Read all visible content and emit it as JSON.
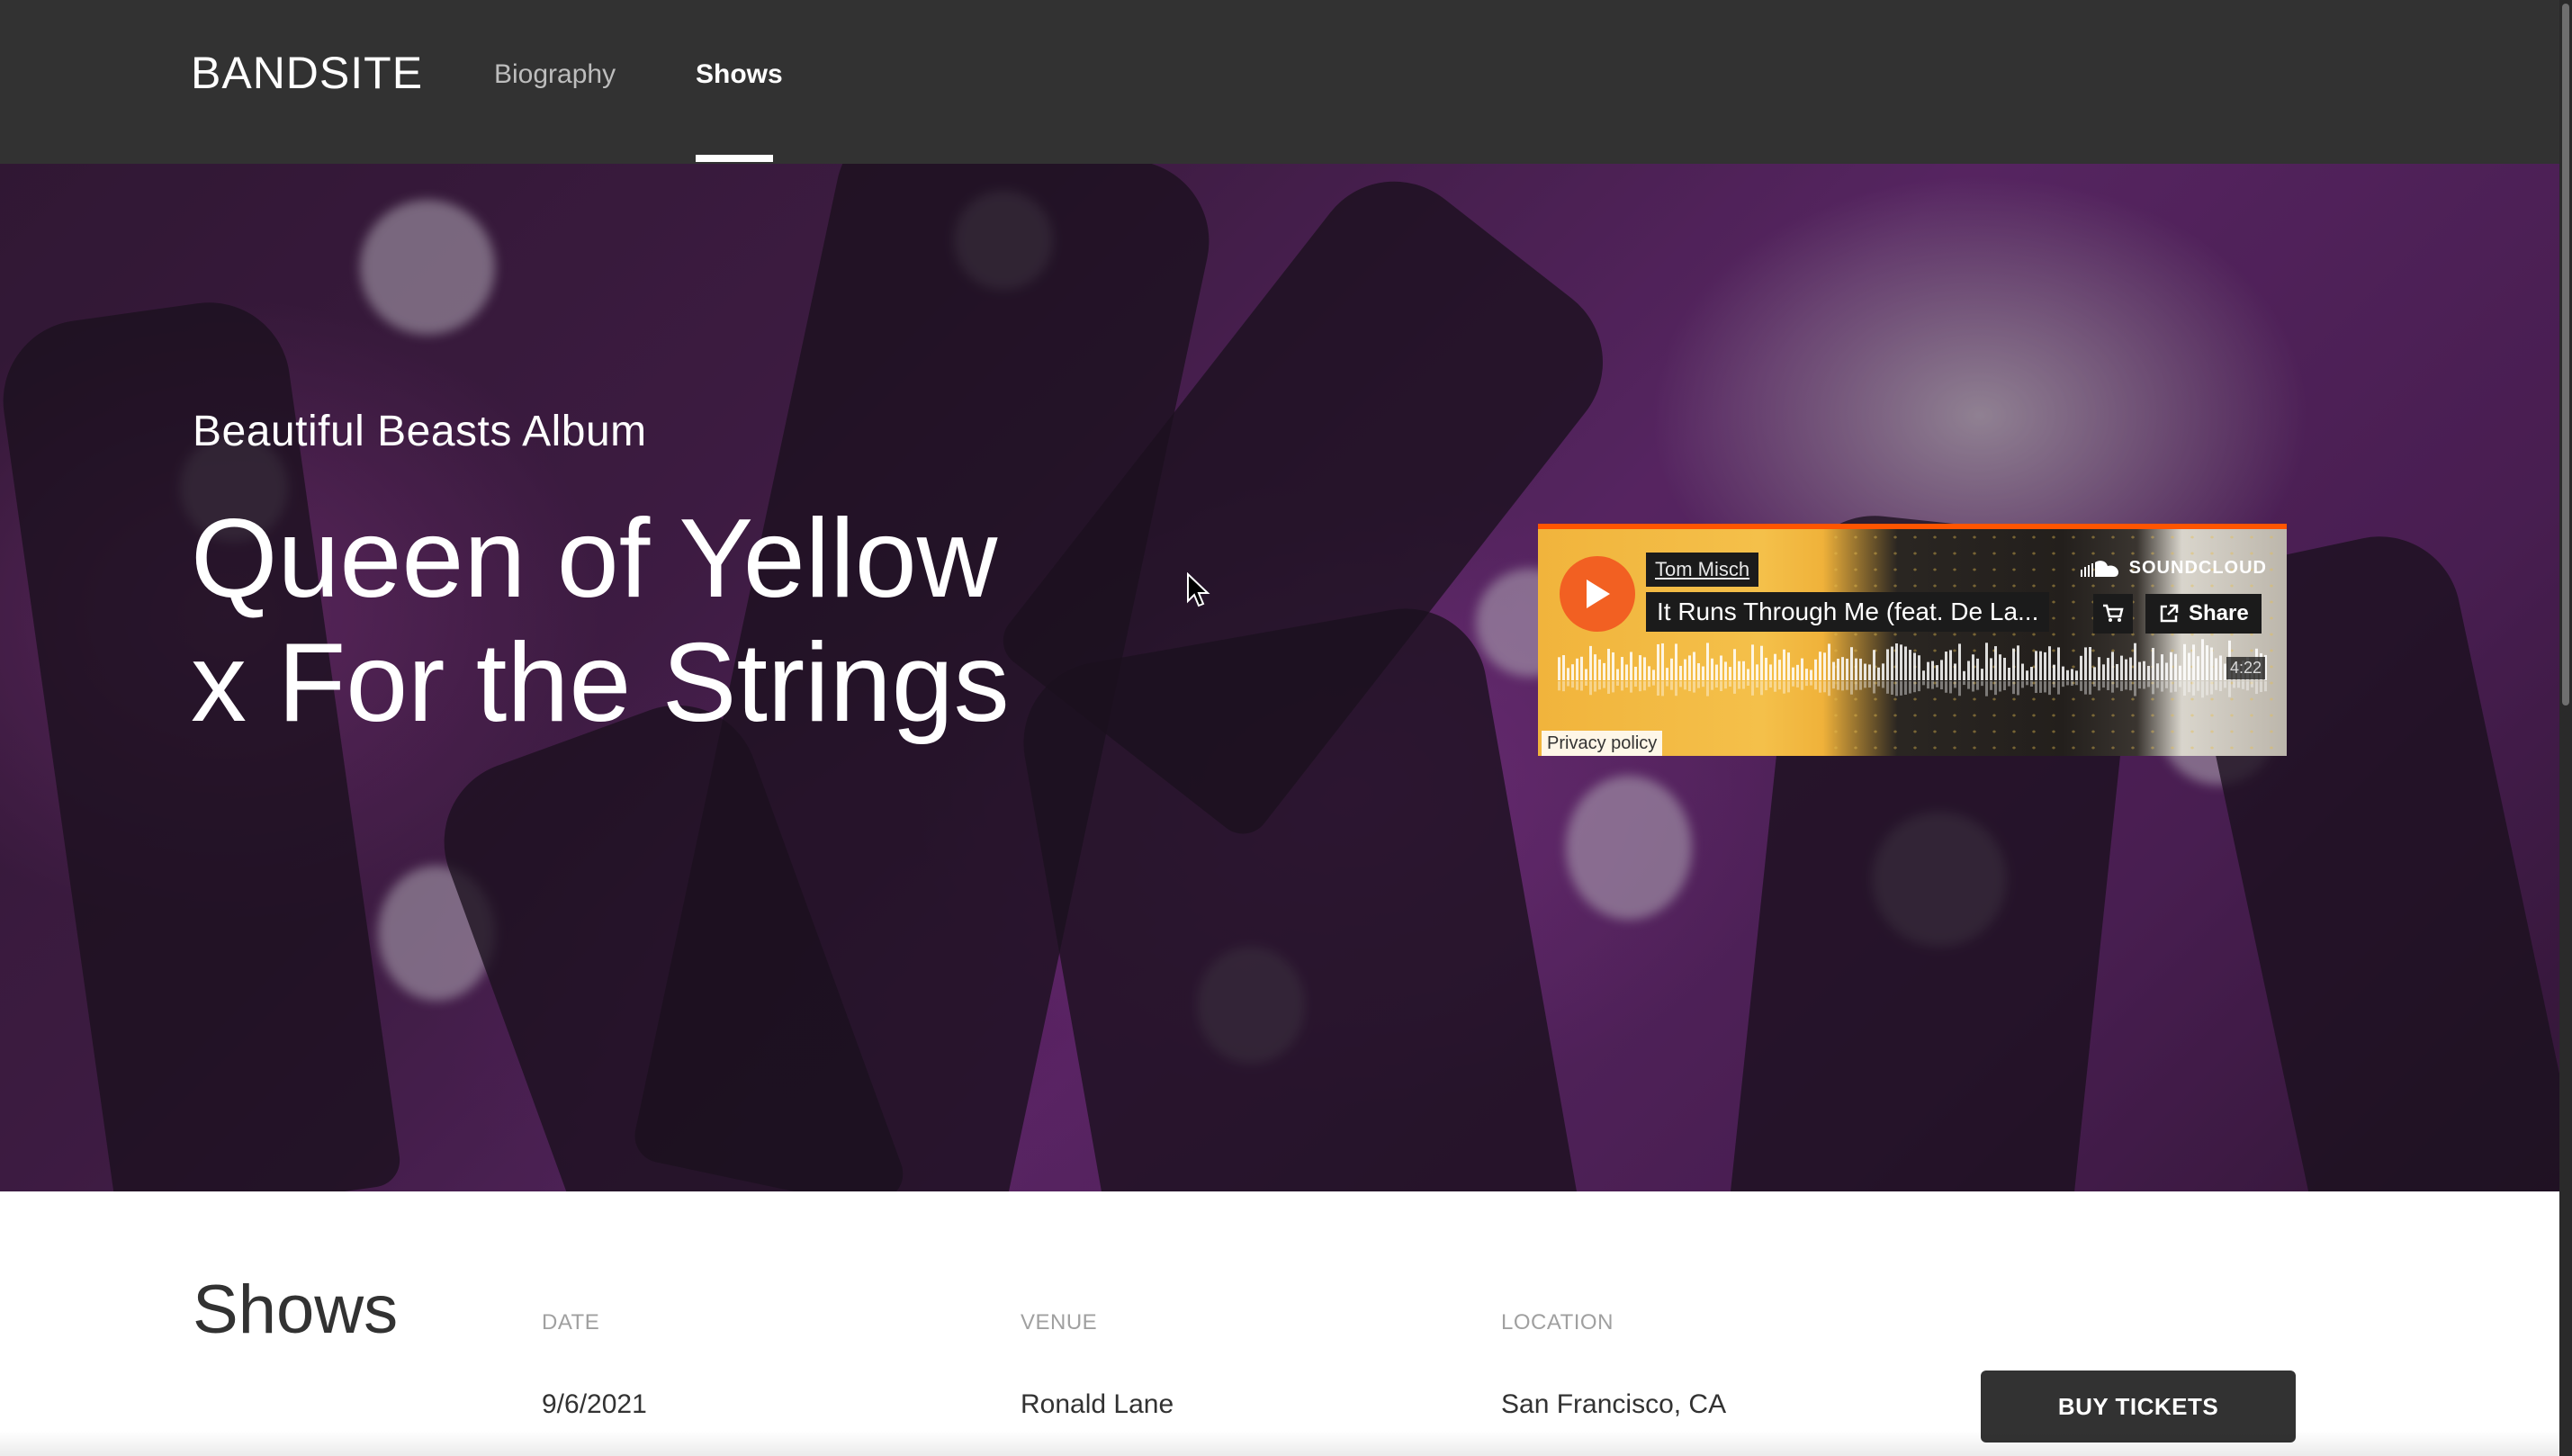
{
  "header": {
    "logo": "BANDSITE",
    "nav": [
      {
        "label": "Biography",
        "active": false
      },
      {
        "label": "Shows",
        "active": true
      }
    ]
  },
  "hero": {
    "subtitle": "Beautiful Beasts Album",
    "title": "Queen of Yellow\nx For the Strings"
  },
  "soundcloud": {
    "artist": "Tom Misch",
    "track": "It Runs Through Me (feat. De La...",
    "brand": "SOUNDCLOUD",
    "share_label": "Share",
    "duration": "4:22",
    "privacy_label": "Privacy policy",
    "accent_color": "#ff5500",
    "play_color": "#f26022",
    "icons": [
      "play-icon",
      "soundcloud-logo-icon",
      "cart-icon",
      "share-icon"
    ]
  },
  "shows": {
    "heading": "Shows",
    "columns": [
      "DATE",
      "VENUE",
      "LOCATION"
    ],
    "rows": [
      {
        "date": "9/6/2021",
        "venue": "Ronald Lane",
        "location": "San Francisco, CA",
        "button_label": "BUY TICKETS"
      }
    ]
  },
  "colors": {
    "header_bg": "#323232",
    "text_dark": "#323232",
    "column_header": "#a0a0a0",
    "button_bg": "#323232"
  }
}
